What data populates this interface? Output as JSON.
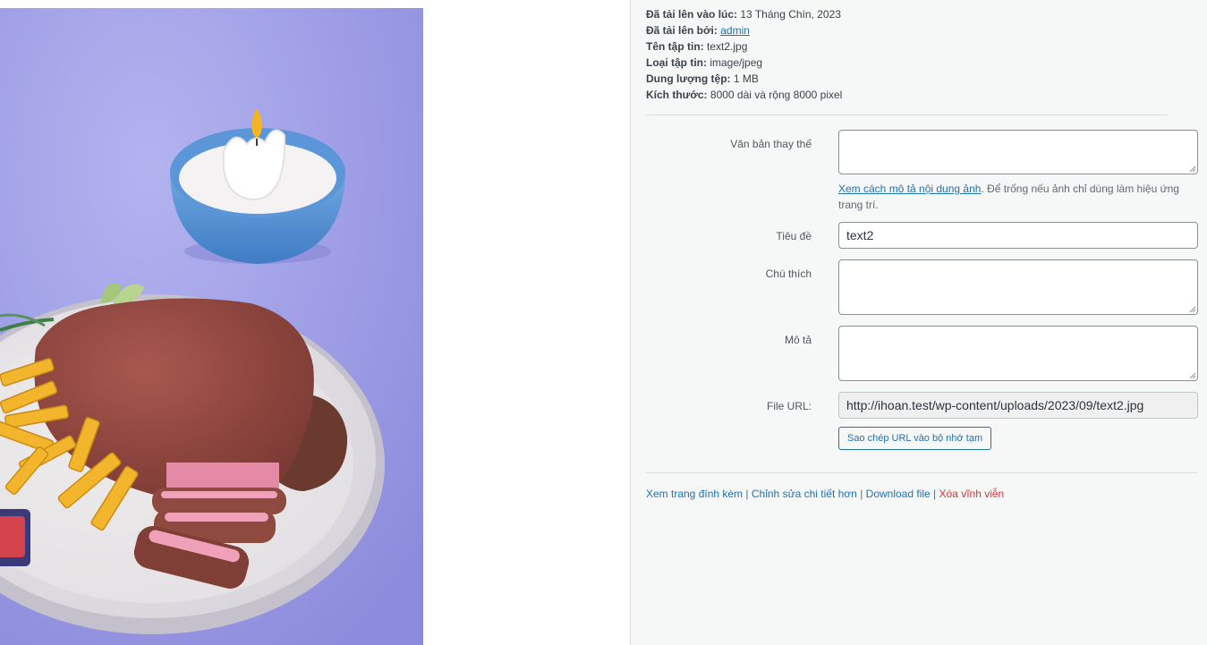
{
  "meta": {
    "uploaded_on_label": "Đã tải lên vào lúc:",
    "uploaded_on_value": "13 Tháng Chín, 2023",
    "uploaded_by_label": "Đã tải lên bởi:",
    "uploaded_by_value": "admin",
    "filename_label": "Tên tập tin:",
    "filename_value": "text2.jpg",
    "filetype_label": "Loại tập tin:",
    "filetype_value": "image/jpeg",
    "filesize_label": "Dung lượng tệp:",
    "filesize_value": "1 MB",
    "dimensions_label": "Kích thước:",
    "dimensions_value": "8000 dài và rộng 8000 pixel"
  },
  "form": {
    "alt_label": "Văn bản thay thế",
    "alt_value": "",
    "alt_help_link": "Xem cách mô tả nội dung ảnh",
    "alt_help_text": ". Để trống nếu ảnh chỉ dùng làm hiệu ứng trang trí.",
    "title_label": "Tiêu đề",
    "title_value": "text2",
    "caption_label": "Chú thích",
    "caption_value": "",
    "description_label": "Mô tả",
    "description_value": "",
    "url_label": "File URL:",
    "url_value": "http://ihoan.test/wp-content/uploads/2023/09/text2.jpg",
    "copy_button": "Sao chép URL vào bộ nhớ tạm"
  },
  "actions": {
    "view": "Xem trang đính kèm",
    "edit": "Chỉnh sửa chi tiết hơn",
    "download": "Download file",
    "delete": "Xóa vĩnh viễn",
    "separator": "|"
  },
  "colors": {
    "link": "#2271b1",
    "delete": "#d63638",
    "background_purple": "#9a9ae4"
  }
}
